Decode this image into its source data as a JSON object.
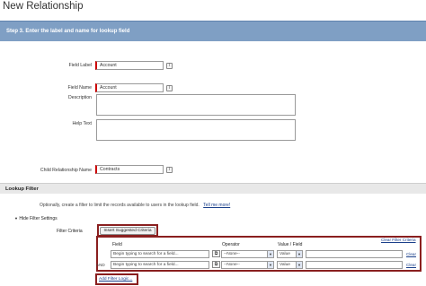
{
  "page": {
    "title": "New Relationship"
  },
  "step": {
    "title": "Step 3. Enter the label and name for lookup field"
  },
  "form": {
    "field_label": {
      "label": "Field Label",
      "value": "Account"
    },
    "field_name": {
      "label": "Field Name",
      "value": "Account"
    },
    "description": {
      "label": "Description"
    },
    "help_text": {
      "label": "Help Text"
    },
    "child_relationship": {
      "label": "Child Relationship Name",
      "value": "Contracts"
    },
    "info_glyph": "i"
  },
  "lookup_filter": {
    "section_title": "Lookup Filter",
    "description": "Optionally, create a filter to limit the records available to users in the lookup field.",
    "tell_me_more": "Tell me more!",
    "hide_settings": "Hide Filter Settings",
    "criteria_label": "Filter Criteria",
    "insert_suggested": "Insert Suggested Criteria",
    "clear_filter": "Clear Filter Criteria",
    "columns": {
      "field": "Field",
      "operator": "Operator",
      "value": "Value / Field"
    },
    "rows": [
      {
        "prefix": "",
        "field_placeholder": "Begin typing to search for a field...",
        "operator": "--None--",
        "value_type": "Value",
        "clear": "Clear"
      },
      {
        "prefix": "AND",
        "field_placeholder": "Begin typing to search for a field...",
        "operator": "--None--",
        "value_type": "Value",
        "clear": "Clear"
      }
    ],
    "add_logic": "Add Filter Logic..."
  }
}
